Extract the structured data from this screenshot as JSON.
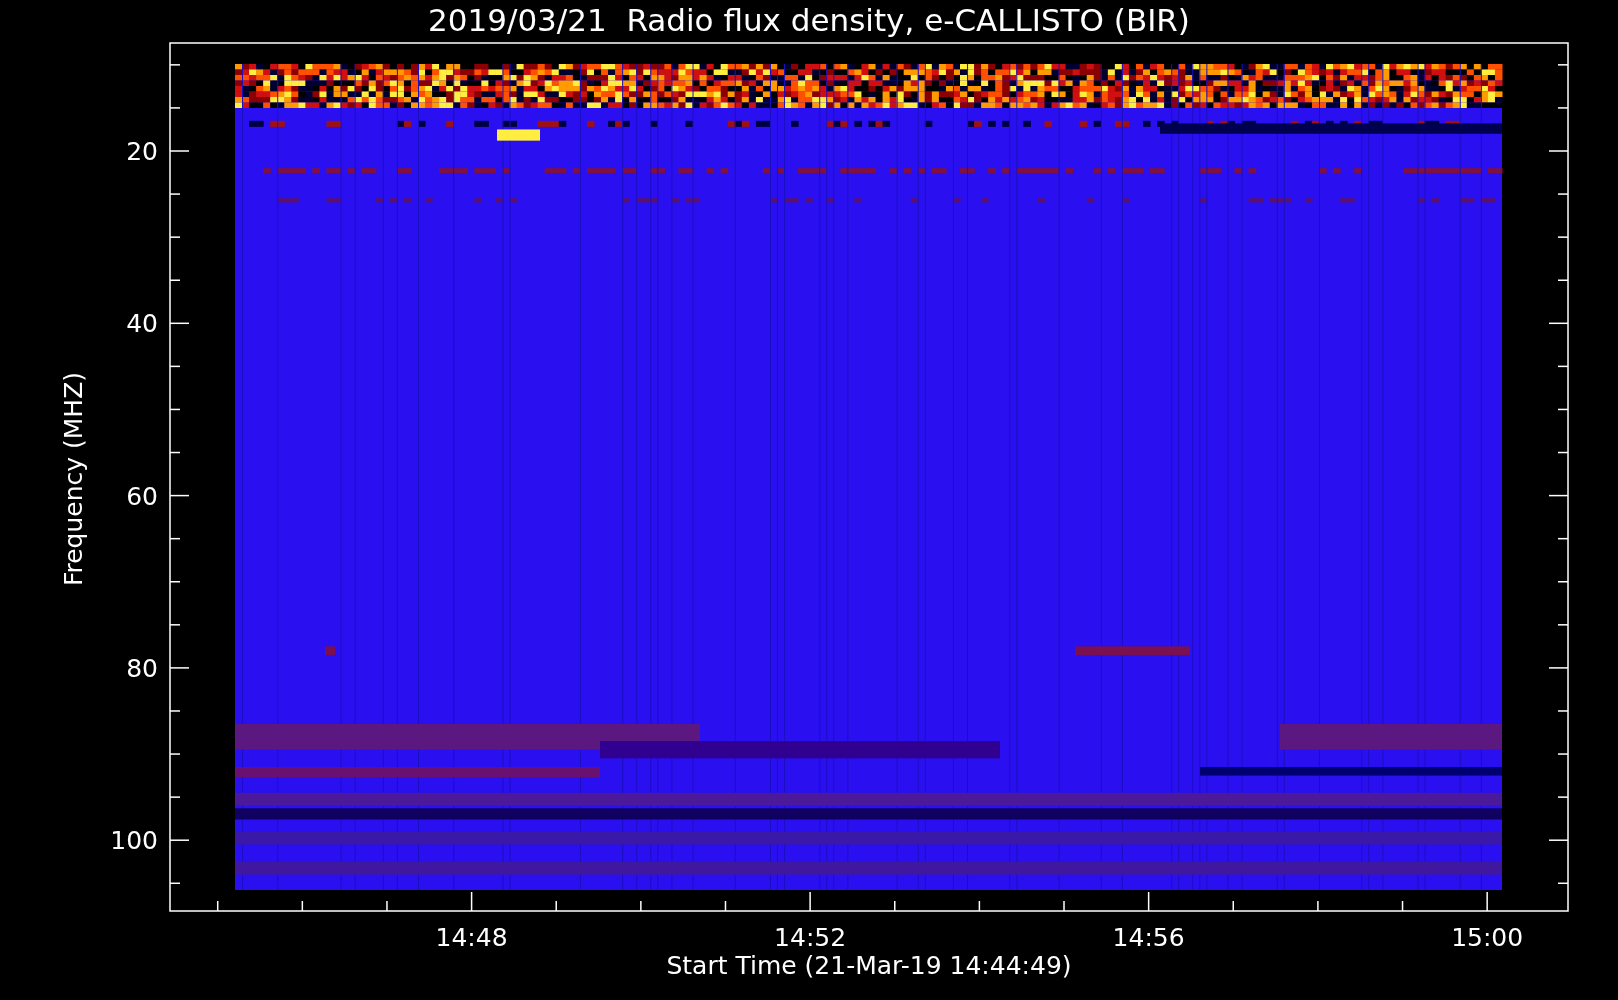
{
  "plot": {
    "title": "2019/03/21  Radio flux density, e-CALLISTO (BIR)",
    "x_axis": {
      "label": "Start Time (21-Mar-19 14:44:49)",
      "ticks": [
        "14:48",
        "14:52",
        "14:56",
        "15:00"
      ]
    },
    "y_axis": {
      "label": "Frequency (MHZ)",
      "ticks": [
        "20",
        "40",
        "60",
        "80",
        "100"
      ]
    }
  }
}
